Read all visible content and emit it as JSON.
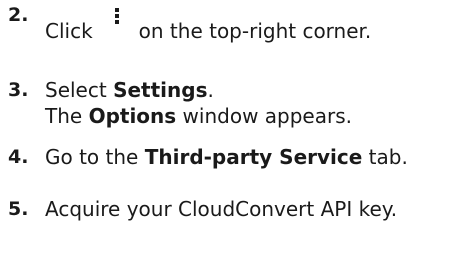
{
  "steps": [
    {
      "number": "2.",
      "text_before_icon": "Click",
      "icon": "kebab-menu-icon",
      "text_after_icon": "on the top-right corner."
    },
    {
      "number": "3.",
      "line1_before": "Select ",
      "line1_bold": "Settings",
      "line1_after": ".",
      "line2_before": "The ",
      "line2_bold": "Options",
      "line2_after": " window appears."
    },
    {
      "number": "4.",
      "text_before": "Go to the ",
      "text_bold": "Third-party Service",
      "text_after": " tab."
    },
    {
      "number": "5.",
      "text": "Acquire your CloudConvert API key."
    }
  ]
}
